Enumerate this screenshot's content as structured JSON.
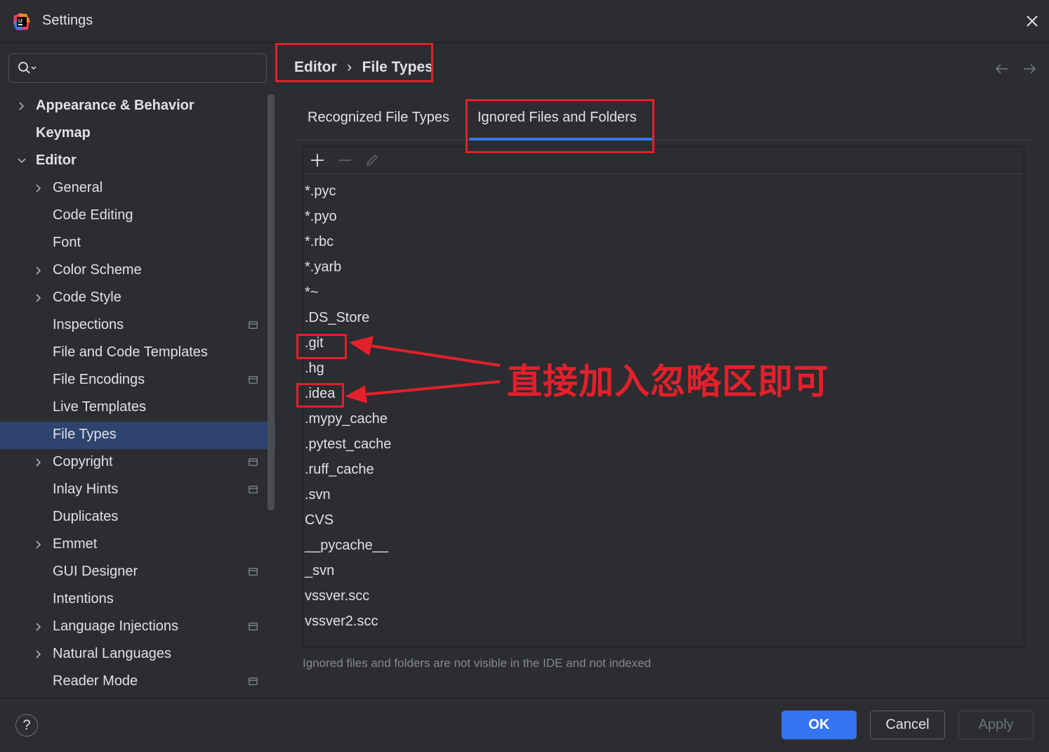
{
  "window": {
    "title": "Settings"
  },
  "search": {
    "placeholder": ""
  },
  "sidebar": {
    "items": [
      {
        "label": "Appearance & Behavior",
        "bold": true,
        "chevron": "right",
        "level": 0
      },
      {
        "label": "Keymap",
        "bold": true,
        "chevron": "none",
        "level": 0
      },
      {
        "label": "Editor",
        "bold": true,
        "chevron": "down",
        "level": 0
      },
      {
        "label": "General",
        "chevron": "right",
        "level": 1
      },
      {
        "label": "Code Editing",
        "chevron": "none",
        "level": 1
      },
      {
        "label": "Font",
        "chevron": "none",
        "level": 1
      },
      {
        "label": "Color Scheme",
        "chevron": "right",
        "level": 1
      },
      {
        "label": "Code Style",
        "chevron": "right",
        "level": 1
      },
      {
        "label": "Inspections",
        "chevron": "none",
        "level": 1,
        "project_icon": true
      },
      {
        "label": "File and Code Templates",
        "chevron": "none",
        "level": 1
      },
      {
        "label": "File Encodings",
        "chevron": "none",
        "level": 1,
        "project_icon": true
      },
      {
        "label": "Live Templates",
        "chevron": "none",
        "level": 1
      },
      {
        "label": "File Types",
        "chevron": "none",
        "level": 1,
        "selected": true
      },
      {
        "label": "Copyright",
        "chevron": "right",
        "level": 1,
        "project_icon": true
      },
      {
        "label": "Inlay Hints",
        "chevron": "none",
        "level": 1,
        "project_icon": true
      },
      {
        "label": "Duplicates",
        "chevron": "none",
        "level": 1
      },
      {
        "label": "Emmet",
        "chevron": "right",
        "level": 1
      },
      {
        "label": "GUI Designer",
        "chevron": "none",
        "level": 1,
        "project_icon": true
      },
      {
        "label": "Intentions",
        "chevron": "none",
        "level": 1
      },
      {
        "label": "Language Injections",
        "chevron": "right",
        "level": 1,
        "project_icon": true
      },
      {
        "label": "Natural Languages",
        "chevron": "right",
        "level": 1
      },
      {
        "label": "Reader Mode",
        "chevron": "none",
        "level": 1,
        "project_icon": true
      }
    ]
  },
  "breadcrumb": {
    "parent": "Editor",
    "separator": "›",
    "current": "File Types"
  },
  "tabs": [
    {
      "label": "Recognized File Types",
      "active": false
    },
    {
      "label": "Ignored Files and Folders",
      "active": true
    }
  ],
  "ignored_list": {
    "toolbar": [
      "add-icon",
      "remove-icon",
      "edit-icon"
    ],
    "items": [
      "*.pyc",
      "*.pyo",
      "*.rbc",
      "*.yarb",
      "*~",
      ".DS_Store",
      ".git",
      ".hg",
      ".idea",
      ".mypy_cache",
      ".pytest_cache",
      ".ruff_cache",
      ".svn",
      "CVS",
      "__pycache__",
      "_svn",
      "vssver.scc",
      "vssver2.scc"
    ],
    "hint": "Ignored files and folders are not visible in the IDE and not indexed"
  },
  "annotation": {
    "text": "直接加入忽略区即可",
    "color": "#e3202b"
  },
  "footer": {
    "ok_label": "OK",
    "cancel_label": "Cancel",
    "apply_label": "Apply",
    "help_label": "?"
  },
  "colors": {
    "background": "#2b2d30",
    "selection": "#2e436e",
    "accent": "#3574f0",
    "annotation_red": "#e3202b"
  }
}
